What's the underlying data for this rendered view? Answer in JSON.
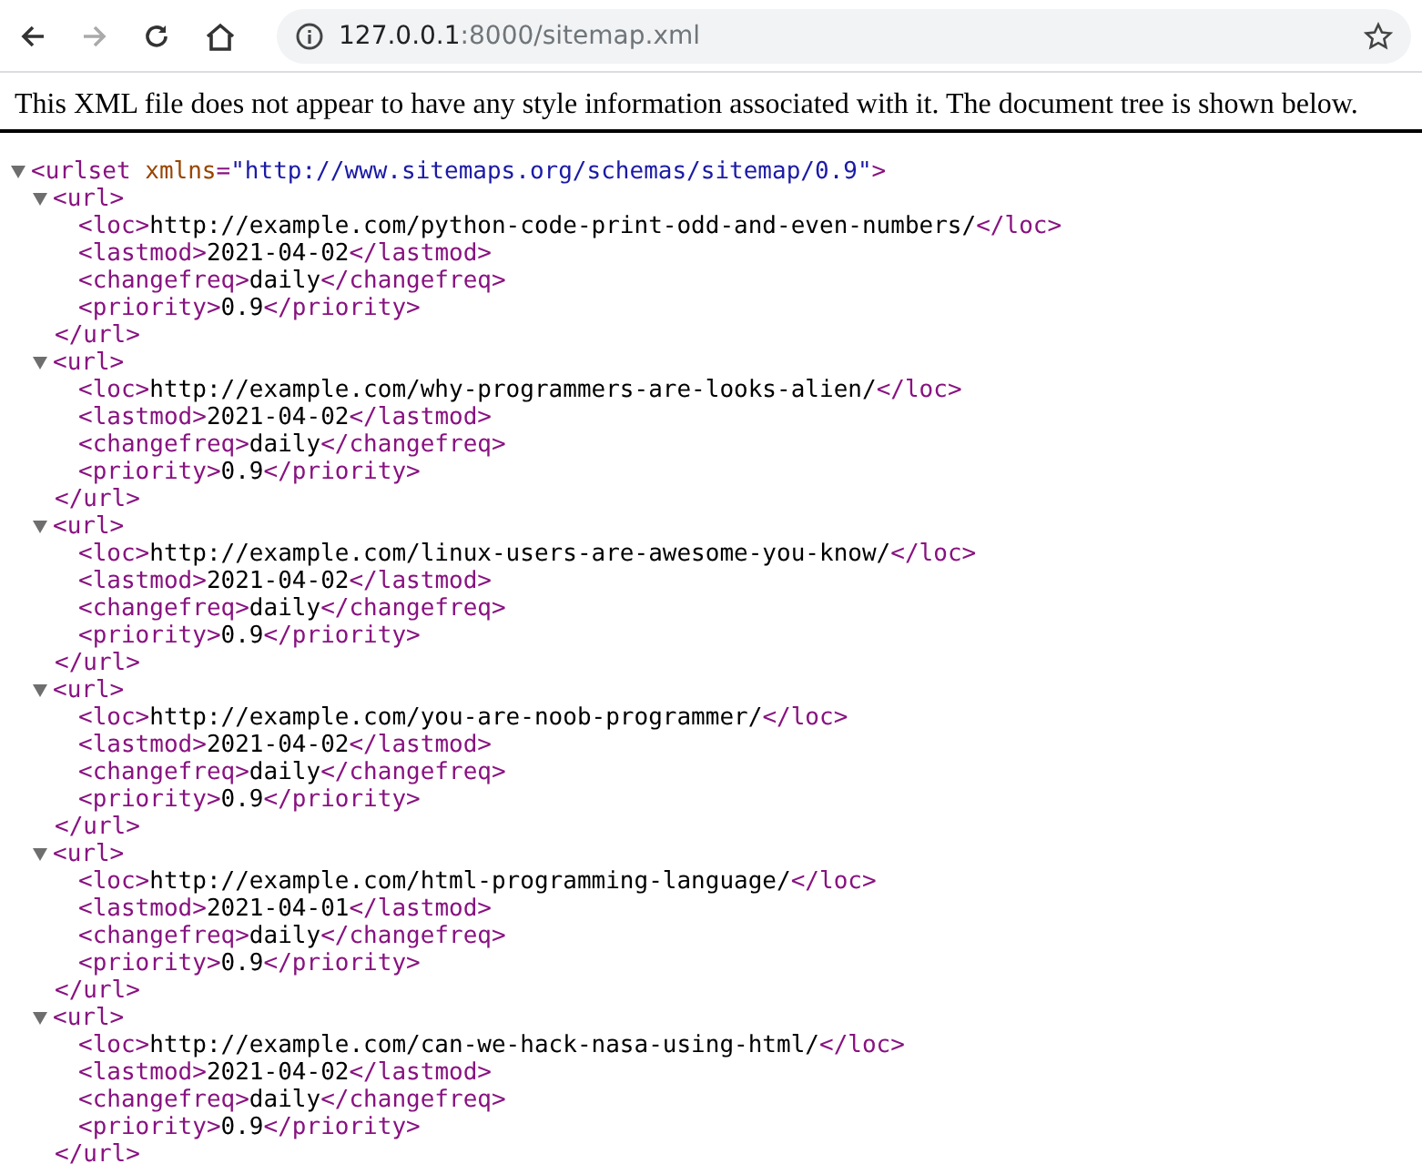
{
  "toolbar": {
    "address_host": "127.0.0.1",
    "address_path": ":8000/sitemap.xml"
  },
  "notice": "This XML file does not appear to have any style information associated with it. The document tree is shown below.",
  "tree": {
    "open": "<urlset",
    "attr_name": "xmlns",
    "attr_eq": "=",
    "attr_value": "\"http://www.sitemaps.org/schemas/sitemap/0.9\"",
    "open_end": ">",
    "expanded": true,
    "children": [
      {
        "open": "<url>",
        "close": "</url>",
        "expanded": true,
        "children": [
          {
            "open": "<loc>",
            "value": "http://example.com/python-code-print-odd-and-even-numbers/",
            "close": "</loc>"
          },
          {
            "open": "<lastmod>",
            "value": "2021-04-02",
            "close": "</lastmod>"
          },
          {
            "open": "<changefreq>",
            "value": "daily",
            "close": "</changefreq>"
          },
          {
            "open": "<priority>",
            "value": "0.9",
            "close": "</priority>"
          }
        ]
      },
      {
        "open": "<url>",
        "close": "</url>",
        "expanded": true,
        "children": [
          {
            "open": "<loc>",
            "value": "http://example.com/why-programmers-are-looks-alien/",
            "close": "</loc>"
          },
          {
            "open": "<lastmod>",
            "value": "2021-04-02",
            "close": "</lastmod>"
          },
          {
            "open": "<changefreq>",
            "value": "daily",
            "close": "</changefreq>"
          },
          {
            "open": "<priority>",
            "value": "0.9",
            "close": "</priority>"
          }
        ]
      },
      {
        "open": "<url>",
        "close": "</url>",
        "expanded": true,
        "children": [
          {
            "open": "<loc>",
            "value": "http://example.com/linux-users-are-awesome-you-know/",
            "close": "</loc>"
          },
          {
            "open": "<lastmod>",
            "value": "2021-04-02",
            "close": "</lastmod>"
          },
          {
            "open": "<changefreq>",
            "value": "daily",
            "close": "</changefreq>"
          },
          {
            "open": "<priority>",
            "value": "0.9",
            "close": "</priority>"
          }
        ]
      },
      {
        "open": "<url>",
        "close": "</url>",
        "expanded": true,
        "children": [
          {
            "open": "<loc>",
            "value": "http://example.com/you-are-noob-programmer/",
            "close": "</loc>"
          },
          {
            "open": "<lastmod>",
            "value": "2021-04-02",
            "close": "</lastmod>"
          },
          {
            "open": "<changefreq>",
            "value": "daily",
            "close": "</changefreq>"
          },
          {
            "open": "<priority>",
            "value": "0.9",
            "close": "</priority>"
          }
        ]
      },
      {
        "open": "<url>",
        "close": "</url>",
        "expanded": true,
        "children": [
          {
            "open": "<loc>",
            "value": "http://example.com/html-programming-language/",
            "close": "</loc>"
          },
          {
            "open": "<lastmod>",
            "value": "2021-04-01",
            "close": "</lastmod>"
          },
          {
            "open": "<changefreq>",
            "value": "daily",
            "close": "</changefreq>"
          },
          {
            "open": "<priority>",
            "value": "0.9",
            "close": "</priority>"
          }
        ]
      },
      {
        "open": "<url>",
        "close": "</url>",
        "expanded": true,
        "children": [
          {
            "open": "<loc>",
            "value": "http://example.com/can-we-hack-nasa-using-html/",
            "close": "</loc>"
          },
          {
            "open": "<lastmod>",
            "value": "2021-04-02",
            "close": "</lastmod>"
          },
          {
            "open": "<changefreq>",
            "value": "daily",
            "close": "</changefreq>"
          },
          {
            "open": "<priority>",
            "value": "0.9",
            "close": "</priority>"
          }
        ]
      }
    ]
  }
}
